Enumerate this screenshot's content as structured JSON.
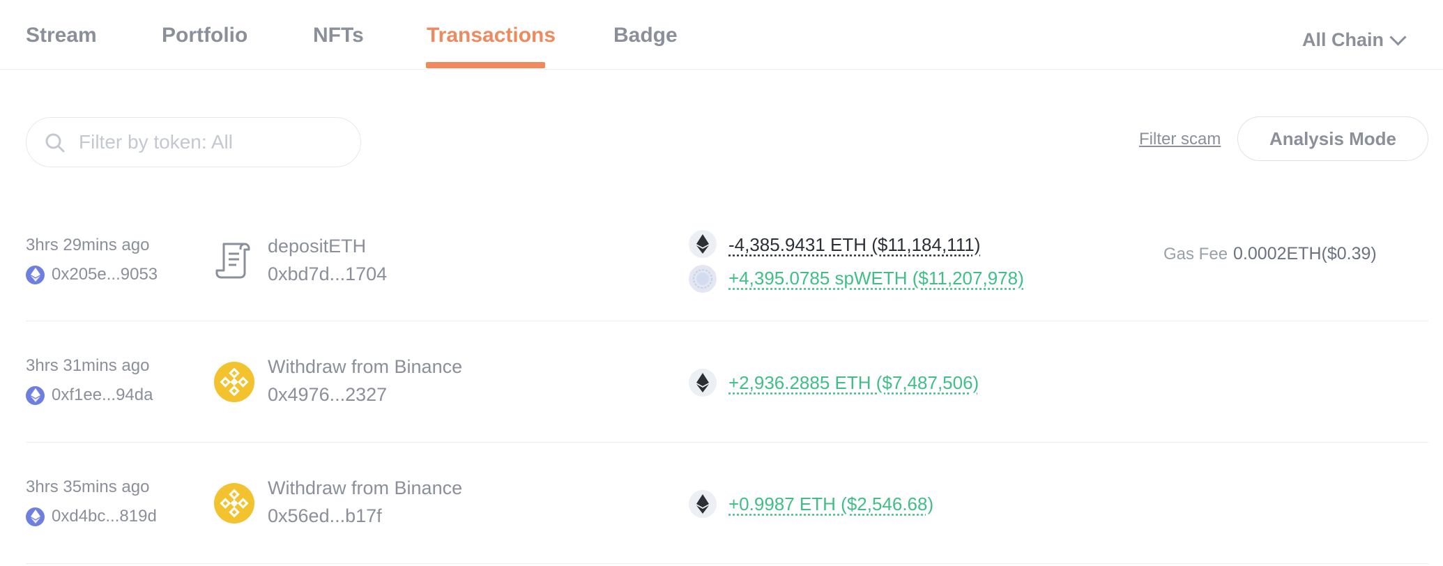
{
  "tabs": [
    {
      "label": "Stream"
    },
    {
      "label": "Portfolio"
    },
    {
      "label": "NFTs"
    },
    {
      "label": "Transactions",
      "active": true
    },
    {
      "label": "Badge"
    }
  ],
  "chain_select": {
    "label": "All Chain"
  },
  "search": {
    "placeholder": "Filter by token: All",
    "value": ""
  },
  "filter_scam": {
    "label": "Filter scam"
  },
  "analysis_mode": {
    "label": "Analysis Mode"
  },
  "transactions": [
    {
      "time": "3hrs 29mins ago",
      "address": "0x205e...9053",
      "method": "depositETH",
      "contract": "0xbd7d...1704",
      "method_icon": "contract-icon",
      "changes": [
        {
          "token_icon": "eth-icon",
          "text": "-4,385.9431 ETH ($11,184,111)",
          "direction": "out"
        },
        {
          "token_icon": "spweth-icon",
          "text": "+4,395.0785 spWETH ($11,207,978)",
          "direction": "in"
        }
      ],
      "gas_label": "Gas Fee",
      "gas_value": "0.0002ETH($0.39)"
    },
    {
      "time": "3hrs 31mins ago",
      "address": "0xf1ee...94da",
      "method": "Withdraw from Binance",
      "contract": "0x4976...2327",
      "method_icon": "binance-icon",
      "changes": [
        {
          "token_icon": "eth-icon",
          "text": "+2,936.2885 ETH ($7,487,506)",
          "direction": "in"
        }
      ]
    },
    {
      "time": "3hrs 35mins ago",
      "address": "0xd4bc...819d",
      "method": "Withdraw from Binance",
      "contract": "0x56ed...b17f",
      "method_icon": "binance-icon",
      "changes": [
        {
          "token_icon": "eth-icon",
          "text": "+0.9987 ETH ($2,546.68)",
          "direction": "in"
        }
      ]
    }
  ],
  "colors": {
    "accent": "#ef8a5f",
    "positive": "#3fbf86",
    "negative": "#2b2f36",
    "muted": "#8a8f99"
  }
}
